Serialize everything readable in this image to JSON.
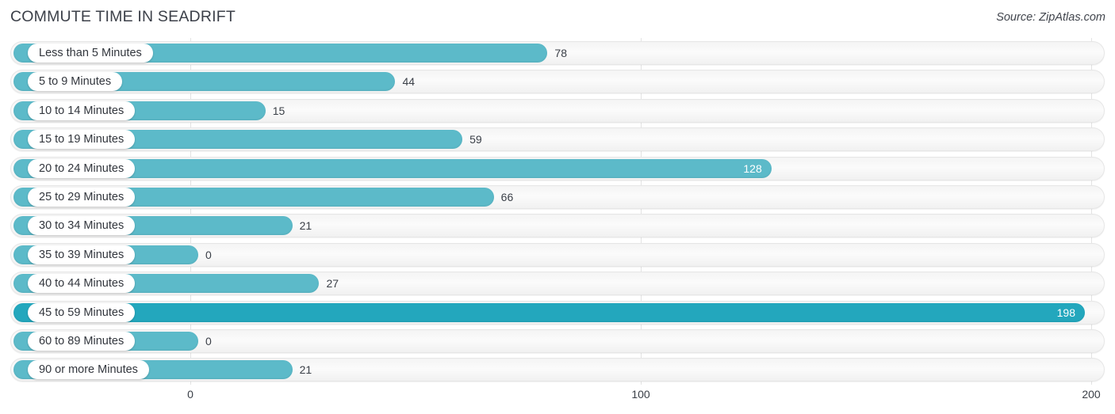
{
  "header": {
    "title": "COMMUTE TIME IN SEADRIFT",
    "source": "Source: ZipAtlas.com"
  },
  "colors": {
    "bar": "#5cbac9",
    "bar_highlight": "#23a7bd",
    "track": "#f6f6f6",
    "gridline": "#e3e3e3",
    "text": "#3a3f47"
  },
  "chart_data": {
    "type": "bar",
    "orientation": "horizontal",
    "title": "COMMUTE TIME IN SEADRIFT",
    "subtitle": "Source: ZipAtlas.com",
    "xlabel": "",
    "ylabel": "",
    "xlim": [
      0,
      200
    ],
    "xticks": [
      0,
      100,
      200
    ],
    "xtick_labels": [
      "0",
      "100",
      "200"
    ],
    "grid": true,
    "legend": "none",
    "categories": [
      "Less than 5 Minutes",
      "5 to 9 Minutes",
      "10 to 14 Minutes",
      "15 to 19 Minutes",
      "20 to 24 Minutes",
      "25 to 29 Minutes",
      "30 to 34 Minutes",
      "35 to 39 Minutes",
      "40 to 44 Minutes",
      "45 to 59 Minutes",
      "60 to 89 Minutes",
      "90 or more Minutes"
    ],
    "values": [
      78,
      44,
      15,
      59,
      128,
      66,
      21,
      0,
      27,
      198,
      0,
      21
    ],
    "value_labels": [
      "78",
      "44",
      "15",
      "59",
      "128",
      "66",
      "21",
      "0",
      "27",
      "198",
      "0",
      "21"
    ],
    "max_value": 198,
    "bars": [
      {
        "label": "Less than 5 Minutes",
        "value": 78,
        "value_label": "78",
        "label_inside": false,
        "highlight": false
      },
      {
        "label": "5 to 9 Minutes",
        "value": 44,
        "value_label": "44",
        "label_inside": false,
        "highlight": false
      },
      {
        "label": "10 to 14 Minutes",
        "value": 15,
        "value_label": "15",
        "label_inside": false,
        "highlight": false
      },
      {
        "label": "15 to 19 Minutes",
        "value": 59,
        "value_label": "59",
        "label_inside": false,
        "highlight": false
      },
      {
        "label": "20 to 24 Minutes",
        "value": 128,
        "value_label": "128",
        "label_inside": true,
        "highlight": false
      },
      {
        "label": "25 to 29 Minutes",
        "value": 66,
        "value_label": "66",
        "label_inside": false,
        "highlight": false
      },
      {
        "label": "30 to 34 Minutes",
        "value": 21,
        "value_label": "21",
        "label_inside": false,
        "highlight": false
      },
      {
        "label": "35 to 39 Minutes",
        "value": 0,
        "value_label": "0",
        "label_inside": false,
        "highlight": false
      },
      {
        "label": "40 to 44 Minutes",
        "value": 27,
        "value_label": "27",
        "label_inside": false,
        "highlight": false
      },
      {
        "label": "45 to 59 Minutes",
        "value": 198,
        "value_label": "198",
        "label_inside": true,
        "highlight": true
      },
      {
        "label": "60 to 89 Minutes",
        "value": 0,
        "value_label": "0",
        "label_inside": false,
        "highlight": false
      },
      {
        "label": "90 or more Minutes",
        "value": 21,
        "value_label": "21",
        "label_inside": false,
        "highlight": false
      }
    ]
  }
}
